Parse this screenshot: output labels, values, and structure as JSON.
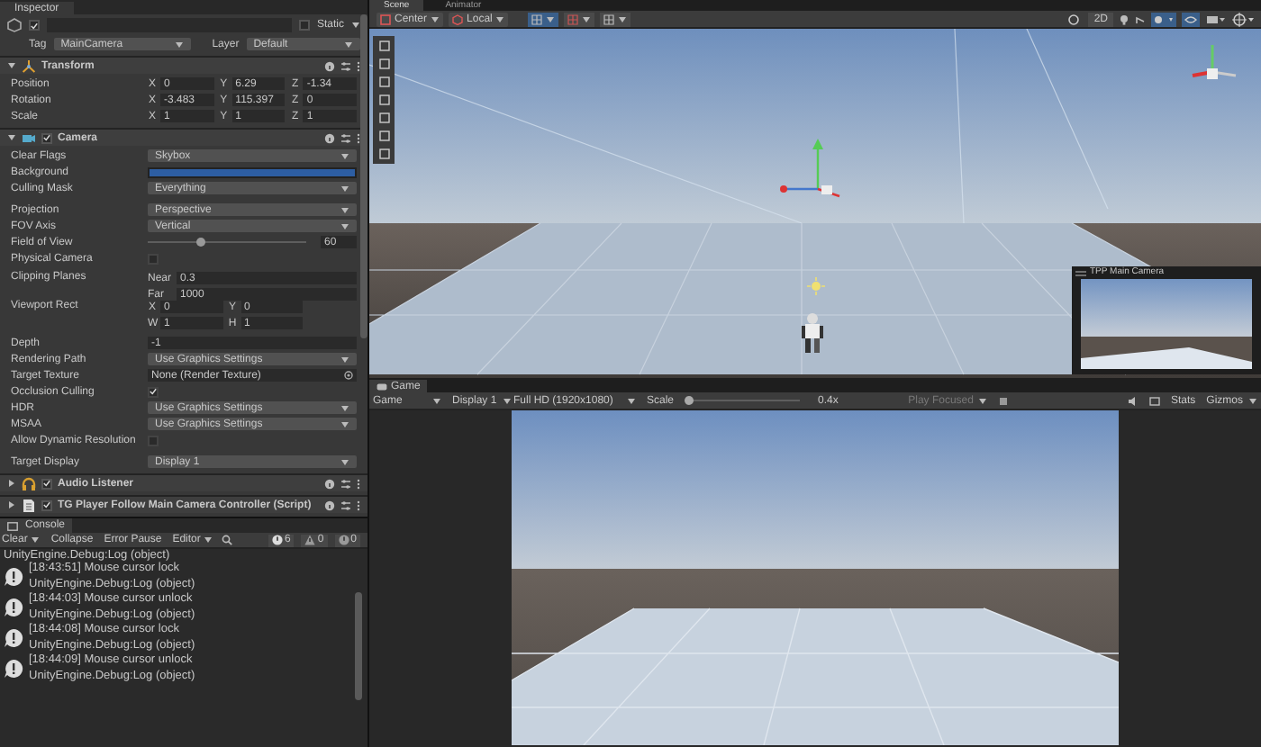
{
  "inspector": {
    "title": "Inspector",
    "active_checked": true,
    "static_checked": false,
    "static_label": "Static",
    "tag_label": "Tag",
    "tag": "MainCamera",
    "layer_label": "Layer",
    "layer": "Default",
    "components": [
      {
        "kind": "transform",
        "title": "Transform",
        "expanded": true,
        "rows": [
          {
            "label": "Position",
            "fields": [
              {
                "axis": "X",
                "value": "0"
              },
              {
                "axis": "Y",
                "value": "6.29"
              },
              {
                "axis": "Z",
                "value": "-1.34"
              }
            ]
          },
          {
            "label": "Rotation",
            "fields": [
              {
                "axis": "X",
                "value": "-3.483"
              },
              {
                "axis": "Y",
                "value": "115.397"
              },
              {
                "axis": "Z",
                "value": "0"
              }
            ]
          },
          {
            "label": "Scale",
            "fields": [
              {
                "axis": "X",
                "value": "1"
              },
              {
                "axis": "Y",
                "value": "1"
              },
              {
                "axis": "Z",
                "value": "1"
              }
            ]
          }
        ]
      },
      {
        "kind": "camera",
        "title": "Camera",
        "enabled": true,
        "expanded": true,
        "groups": [
          [
            {
              "kind": "dropdown",
              "label": "Clear Flags",
              "value": "Skybox"
            },
            {
              "kind": "color",
              "label": "Background"
            },
            {
              "kind": "dropdown",
              "label": "Culling Mask",
              "value": "Everything"
            }
          ],
          [
            {
              "kind": "dropdown",
              "label": "Projection",
              "value": "Perspective"
            },
            {
              "kind": "dropdown",
              "label": "FOV Axis",
              "value": "Vertical"
            },
            {
              "kind": "slider",
              "label": "Field of View",
              "level": 0.33,
              "value": "60"
            },
            {
              "kind": "checkbox",
              "label": "Physical Camera",
              "checked": false
            }
          ],
          [
            {
              "kind": "stack",
              "label": "Clipping Planes",
              "fields": [
                {
                  "axis": "Near",
                  "value": "0.3"
                },
                {
                  "axis": "Far",
                  "value": "1000"
                }
              ]
            },
            {
              "kind": "rect",
              "label": "Viewport Rect",
              "fields": [
                {
                  "axis": "X",
                  "value": "0"
                },
                {
                  "axis": "Y",
                  "value": "0"
                },
                {
                  "axis": "W",
                  "value": "1"
                },
                {
                  "axis": "H",
                  "value": "1"
                }
              ]
            }
          ],
          [
            {
              "kind": "text",
              "label": "Depth",
              "value": "-1"
            },
            {
              "kind": "dropdown",
              "label": "Rendering Path",
              "value": "Use Graphics Settings"
            },
            {
              "kind": "object",
              "label": "Target Texture",
              "value": "None (Render Texture)"
            },
            {
              "kind": "checkbox",
              "label": "Occlusion Culling",
              "checked": true
            },
            {
              "kind": "dropdown",
              "label": "HDR",
              "value": "Use Graphics Settings"
            },
            {
              "kind": "dropdown",
              "label": "MSAA",
              "value": "Use Graphics Settings"
            },
            {
              "kind": "checkbox",
              "label": "Allow Dynamic Resolution",
              "checked": false
            }
          ],
          [
            {
              "kind": "dropdown",
              "label": "Target Display",
              "value": "Display 1"
            }
          ]
        ]
      },
      {
        "kind": "audio",
        "title": "Audio Listener",
        "enabled": true,
        "expanded": false
      },
      {
        "kind": "script",
        "title": "TG Player Follow Main Camera Controller (Script)",
        "enabled": true,
        "expanded": false
      }
    ]
  },
  "console": {
    "title": "Console",
    "buttons": [
      {
        "label": "Clear",
        "dropdown": true
      },
      {
        "label": "Collapse",
        "dropdown": false
      },
      {
        "label": "Error Pause",
        "dropdown": false
      },
      {
        "label": "Editor",
        "dropdown": true
      }
    ],
    "counts": [
      {
        "kind": "info",
        "value": "6"
      },
      {
        "kind": "warning",
        "value": "0"
      },
      {
        "kind": "error",
        "value": "0"
      }
    ],
    "entries": [
      {
        "detail": "UnityEngine.Debug:Log (object)"
      },
      {
        "message": "[18:43:51] Mouse cursor lock",
        "detail": "UnityEngine.Debug:Log (object)"
      },
      {
        "message": "[18:44:03] Mouse cursor unlock",
        "detail": "UnityEngine.Debug:Log (object)"
      },
      {
        "message": "[18:44:08] Mouse cursor lock",
        "detail": "UnityEngine.Debug:Log (object)"
      },
      {
        "message": "[18:44:09] Mouse cursor unlock",
        "detail": "UnityEngine.Debug:Log (object)"
      }
    ]
  },
  "scene": {
    "tabs": [
      {
        "label": "Scene",
        "selected": true
      },
      {
        "label": "Animator",
        "selected": false
      }
    ],
    "pivot": "Center",
    "space": "Local",
    "mode_2d": "2D",
    "camera_preview_title": "TPP Main Camera"
  },
  "game": {
    "tab": "Game",
    "view": "Game",
    "display": "Display 1",
    "resolution": "Full HD (1920x1080)",
    "scale_label": "Scale",
    "scale": {
      "level": 0.0
    },
    "scale_value": "0.4x",
    "play_mode": "Play Focused",
    "stats": "Stats",
    "gizmos": "Gizmos"
  }
}
